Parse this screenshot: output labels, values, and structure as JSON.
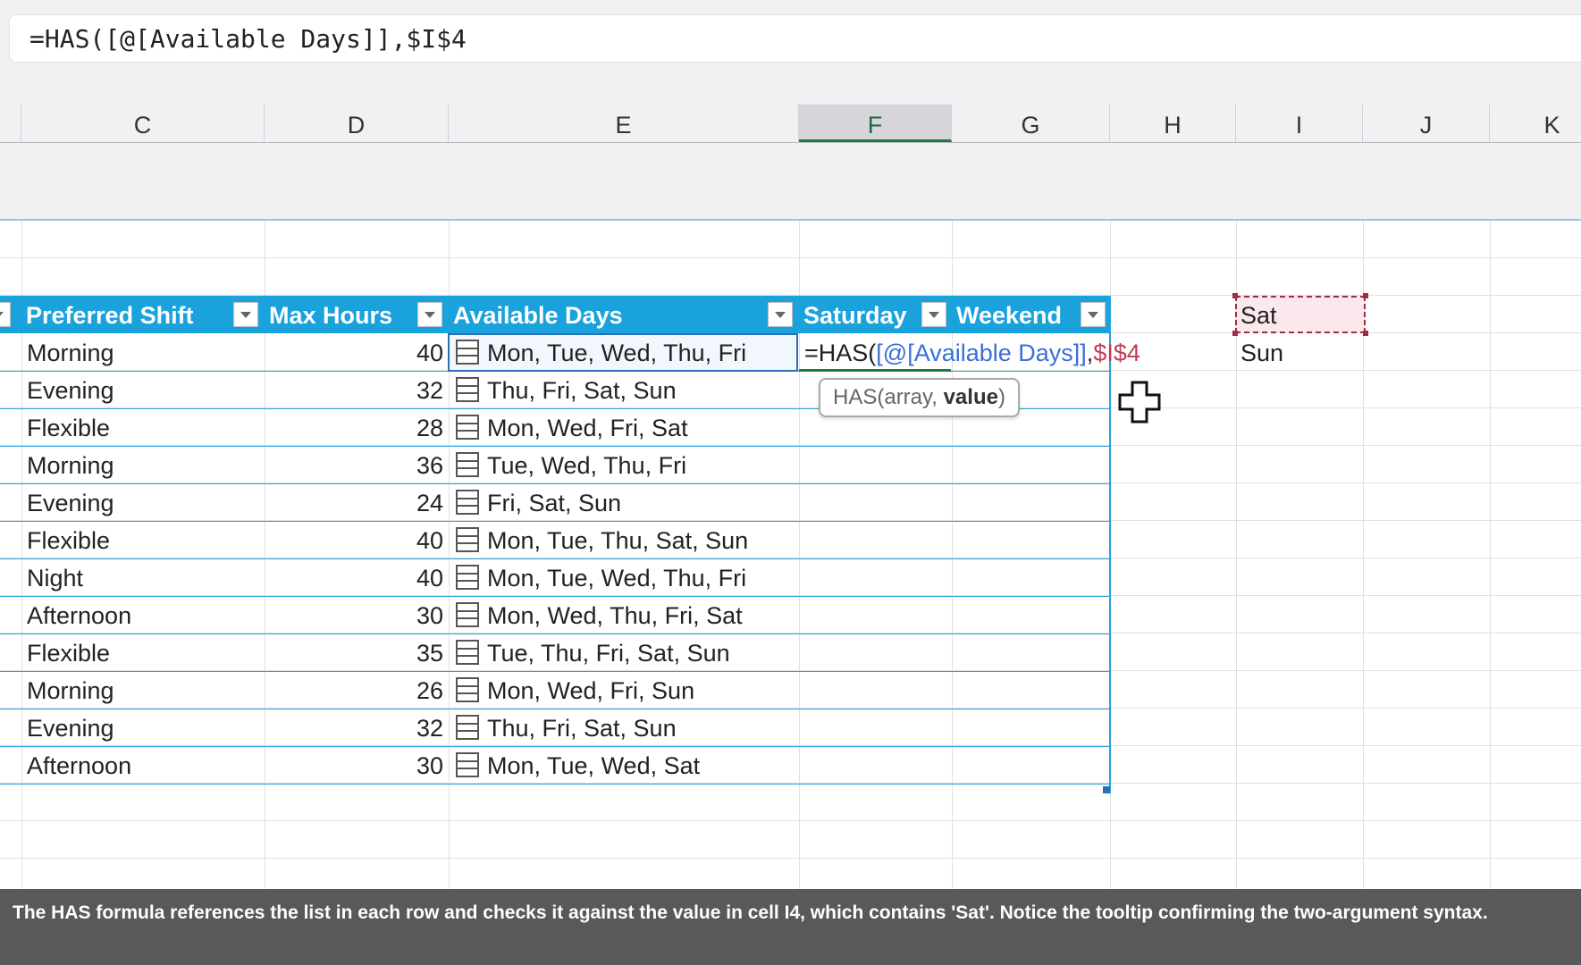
{
  "formula_bar": {
    "text": "=HAS([@[Available Days]],$I$4"
  },
  "column_headers": [
    "C",
    "D",
    "E",
    "F",
    "G",
    "H",
    "I",
    "J",
    "K"
  ],
  "active_column": "F",
  "table": {
    "headers": [
      "Preferred Shift",
      "Max Hours",
      "Available Days",
      "Saturday",
      "Weekend"
    ],
    "rows": [
      {
        "shift": "Morning",
        "hours": "40",
        "days": "Mon, Tue, Wed, Thu, Fri"
      },
      {
        "shift": "Evening",
        "hours": "32",
        "days": "Thu, Fri, Sat, Sun"
      },
      {
        "shift": "Flexible",
        "hours": "28",
        "days": "Mon, Wed, Fri, Sat"
      },
      {
        "shift": "Morning",
        "hours": "36",
        "days": "Tue, Wed, Thu, Fri"
      },
      {
        "shift": "Evening",
        "hours": "24",
        "days": "Fri, Sat, Sun"
      },
      {
        "shift": "Flexible",
        "hours": "40",
        "days": "Mon, Tue, Thu, Sat, Sun"
      },
      {
        "shift": "Night",
        "hours": "40",
        "days": "Mon, Tue, Wed, Thu, Fri"
      },
      {
        "shift": "Afternoon",
        "hours": "30",
        "days": "Mon, Wed, Thu, Fri, Sat"
      },
      {
        "shift": "Flexible",
        "hours": "35",
        "days": "Tue, Thu, Fri, Sat, Sun"
      },
      {
        "shift": "Morning",
        "hours": "26",
        "days": "Mon, Wed, Fri, Sun"
      },
      {
        "shift": "Evening",
        "hours": "32",
        "days": "Thu, Fri, Sat, Sun"
      },
      {
        "shift": "Afternoon",
        "hours": "30",
        "days": "Mon, Tue, Wed, Sat"
      }
    ]
  },
  "in_cell_formula": {
    "prefix": "=HAS(",
    "ref1": "[@[Available Days]]",
    "comma": ",",
    "ref2": "$I$4"
  },
  "tooltip": {
    "fn": "HAS(array, ",
    "arg": "value",
    "close": ")"
  },
  "side_cells": {
    "i4": "Sat",
    "i5": "Sun"
  },
  "caption": "The HAS formula references the list in each row and checks it against the value in cell I4, which contains 'Sat'. Notice the tooltip confirming the two-argument syntax.",
  "colors": {
    "table_header": "#1aa2dc",
    "table_border": "#2aa3d6",
    "active_col": "#1d7a43",
    "ref_blue": "#3a6fd8",
    "ref_red": "#c43a55"
  }
}
